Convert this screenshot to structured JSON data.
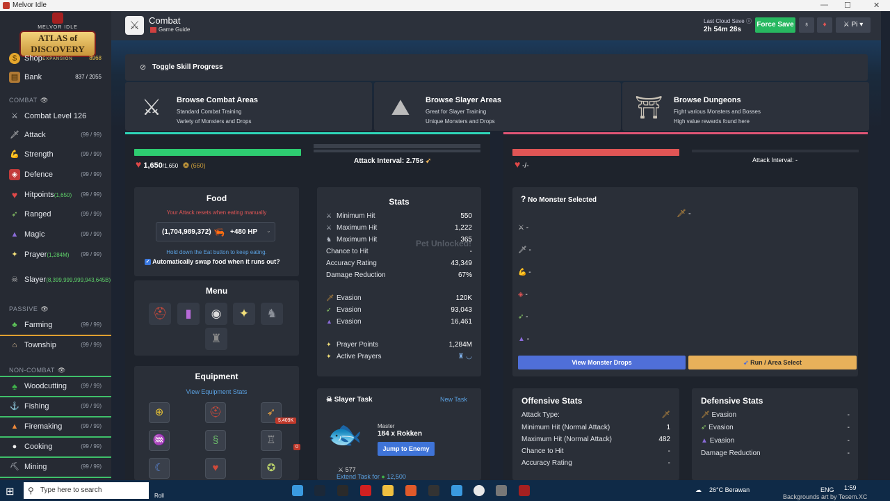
{
  "window": {
    "title": "Melvor Idle"
  },
  "logo": {
    "line1": "MELVOR IDLE",
    "line2": "ATLAS of DISCOVERY",
    "line3": "EXPANSION"
  },
  "sidebar": {
    "shop": {
      "label": "Shop",
      "value": "8968"
    },
    "bank": {
      "label": "Bank",
      "value": "837 / 2055"
    },
    "combat_header": "COMBAT",
    "combat_level": "Combat Level 126",
    "combat_items": [
      {
        "label": "Attack",
        "sub": "",
        "level": "(99 / 99)"
      },
      {
        "label": "Strength",
        "sub": "",
        "level": "(99 / 99)"
      },
      {
        "label": "Defence",
        "sub": "",
        "level": "(99 / 99)"
      },
      {
        "label": "Hitpoints",
        "sub": "(1,650)",
        "level": "(99 / 99)"
      },
      {
        "label": "Ranged",
        "sub": "",
        "level": "(99 / 99)"
      },
      {
        "label": "Magic",
        "sub": "",
        "level": "(99 / 99)"
      },
      {
        "label": "Prayer",
        "sub": "(1,284M)",
        "level": "(99 / 99)"
      },
      {
        "label": "Slayer",
        "sub": "(8,399,999,999,943,645B)",
        "level": ""
      }
    ],
    "passive_header": "PASSIVE",
    "passive_items": [
      {
        "label": "Farming",
        "level": "(99 / 99)"
      },
      {
        "label": "Township",
        "level": "(99 / 99)"
      }
    ],
    "noncombat_header": "NON-COMBAT",
    "noncombat_items": [
      {
        "label": "Woodcutting",
        "level": "(99 / 99)"
      },
      {
        "label": "Fishing",
        "level": "(99 / 99)"
      },
      {
        "label": "Firemaking",
        "level": "(99 / 99)"
      },
      {
        "label": "Cooking",
        "level": "(99 / 99)"
      },
      {
        "label": "Mining",
        "level": "(99 / 99)"
      }
    ]
  },
  "header": {
    "title": "Combat",
    "guide": "Game Guide",
    "cloud_label": "Last Cloud Save",
    "cloud_time": "2h 54m 28s",
    "force_save": "Force Save",
    "profile": "Pi"
  },
  "toggle_skill_progress": "Toggle Skill Progress",
  "browse": [
    {
      "title": "Browse Combat Areas",
      "line1": "Standard Combat Training",
      "line2": "Variety of Monsters and Drops"
    },
    {
      "title": "Browse Slayer Areas",
      "line1": "Great for Slayer Training",
      "line2": "Unique Monsters and Drops"
    },
    {
      "title": "Browse Dungeons",
      "line1": "Fight various Monsters and Bosses",
      "line2": "High value rewards found here"
    }
  ],
  "player": {
    "hp_current": "1,650",
    "hp_max": "/1,650",
    "prayer": "(660)",
    "hp_fraction": 1.0,
    "attack_interval": "Attack Interval: 2.75s"
  },
  "enemy": {
    "hp": "-/-",
    "hp_fraction": 1.0,
    "attack_interval": "Attack Interval: -",
    "no_monster": "No Monster Selected",
    "values": [
      "-",
      "-",
      "-",
      "-",
      "-",
      "-",
      "-"
    ],
    "view_drops": "View Monster Drops",
    "run_area": "Run / Area Select"
  },
  "food": {
    "title": "Food",
    "warning": "Your Attack resets when eating manually",
    "amount": "(1,704,989,372)",
    "heal": "+480 HP",
    "hint": "Hold down the Eat button to keep eating.",
    "auto_swap": "Automatically swap food when it runs out?"
  },
  "menu_title": "Menu",
  "equipment": {
    "title": "Equipment",
    "view_stats": "View Equipment Stats",
    "badge1": "5,409K",
    "badge2": "0"
  },
  "stats": {
    "title": "Stats",
    "rows": [
      {
        "label": "Minimum Hit",
        "value": "550"
      },
      {
        "label": "Maximum Hit",
        "value": "1,222"
      },
      {
        "label": "Maximum Hit",
        "value": "365"
      },
      {
        "label": "Chance to Hit",
        "value": "-"
      },
      {
        "label": "Accuracy Rating",
        "value": "43,349"
      },
      {
        "label": "Damage Reduction",
        "value": "67%"
      },
      {
        "label": "Evasion",
        "value": "120K"
      },
      {
        "label": "Evasion",
        "value": "93,043"
      },
      {
        "label": "Evasion",
        "value": "16,461"
      },
      {
        "label": "Prayer Points",
        "value": "1,284M"
      },
      {
        "label": "Active Prayers",
        "value": ""
      }
    ],
    "pet_overlay": "Pet Unlocked!"
  },
  "slayer": {
    "title": "Slayer Task",
    "new_task": "New Task",
    "tier": "Master",
    "task": "184 x Rokken",
    "jump": "Jump to Enemy",
    "coins": "577",
    "extend": "Extend Task for",
    "extend_cost": "12,500"
  },
  "offensive": {
    "title": "Offensive Stats",
    "rows": [
      {
        "label": "Attack Type:",
        "value": ""
      },
      {
        "label": "Minimum Hit (Normal Attack)",
        "value": "1"
      },
      {
        "label": "Maximum Hit (Normal Attack)",
        "value": "482"
      },
      {
        "label": "Chance to Hit",
        "value": "-"
      },
      {
        "label": "Accuracy Rating",
        "value": "-"
      }
    ]
  },
  "defensive": {
    "title": "Defensive Stats",
    "rows": [
      {
        "label": "Evasion",
        "value": "-"
      },
      {
        "label": "Evasion",
        "value": "-"
      },
      {
        "label": "Evasion",
        "value": "-"
      },
      {
        "label": "Damage Reduction",
        "value": "-"
      }
    ]
  },
  "taskbar": {
    "search": "Type here to search",
    "app_label": "Roll",
    "weather": "26°C  Berawan",
    "lang": "ENG",
    "time": "1:59",
    "watermark": "Backgrounds art by Tesem.XC"
  },
  "colors": {
    "green": "#2ecc71",
    "red": "#e05555",
    "blue": "#4f6fd8",
    "orange": "#e8b15a"
  }
}
